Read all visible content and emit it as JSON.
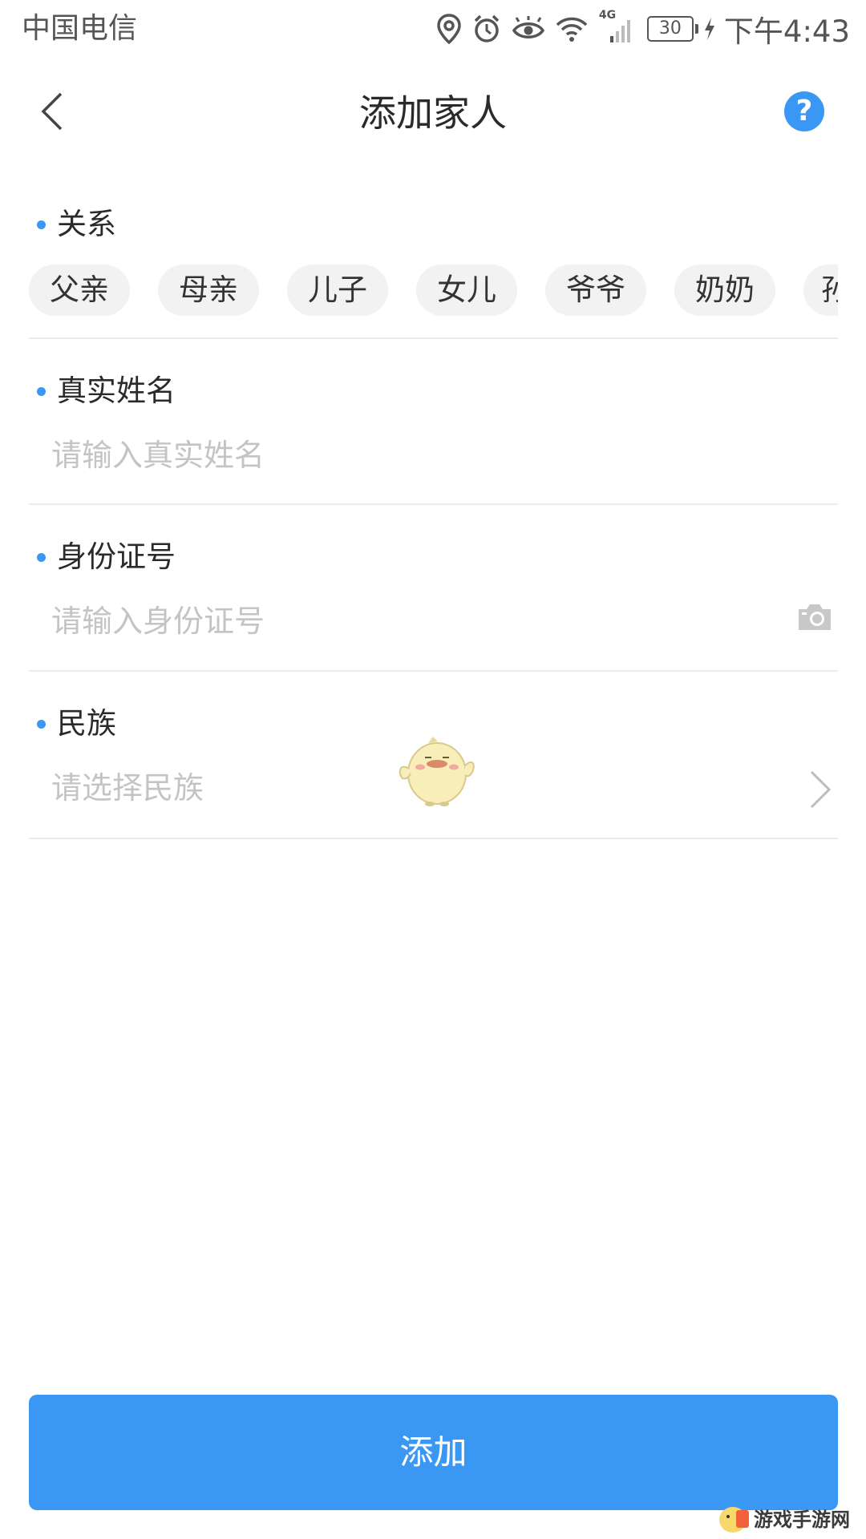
{
  "status_bar": {
    "carrier": "中国电信",
    "network": "4G",
    "battery": "30",
    "time": "下午4:43",
    "icons": [
      "location-icon",
      "alarm-icon",
      "eye-icon",
      "wifi-icon",
      "signal-icon",
      "battery-icon",
      "charging-icon"
    ]
  },
  "nav": {
    "title": "添加家人",
    "help": "?"
  },
  "relation": {
    "label": "关系",
    "options": [
      "父亲",
      "母亲",
      "儿子",
      "女儿",
      "爷爷",
      "奶奶",
      "孙"
    ]
  },
  "name_field": {
    "label": "真实姓名",
    "placeholder": "请输入真实姓名"
  },
  "id_field": {
    "label": "身份证号",
    "placeholder": "请输入身份证号"
  },
  "ethnicity_field": {
    "label": "民族",
    "placeholder": "请选择民族"
  },
  "submit": {
    "label": "添加"
  },
  "watermark": {
    "text": "游戏手游网"
  },
  "colors": {
    "accent": "#3a97f4",
    "chip_bg": "#f2f2f2",
    "placeholder": "#c4c4c4",
    "divider": "#ebebeb"
  }
}
